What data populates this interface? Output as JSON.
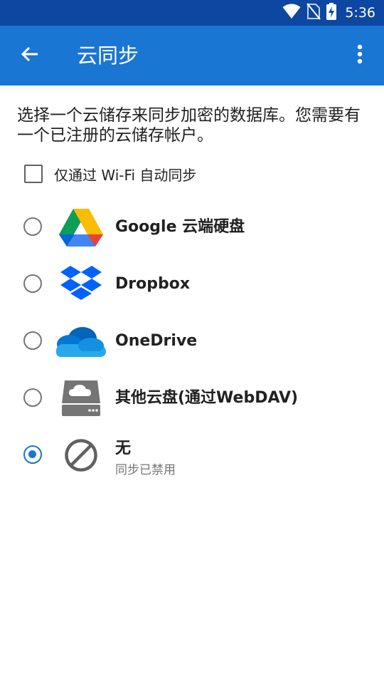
{
  "status_bar": {
    "time": "5:36",
    "icons": [
      "wifi-icon",
      "no-sim-icon",
      "battery-charging-icon"
    ]
  },
  "app_bar": {
    "title": "云同步",
    "back_icon": "arrow-back-icon",
    "overflow_icon": "more-vert-icon"
  },
  "description": "选择一个云储存来同步加密的数据库。您需要有一个已注册的云储存帐户。",
  "wifi_only": {
    "label": "仅通过 Wi-Fi 自动同步",
    "checked": false
  },
  "providers": [
    {
      "label": "Google 云端硬盘",
      "icon": "google-drive-icon",
      "selected": false
    },
    {
      "label": "Dropbox",
      "icon": "dropbox-icon",
      "selected": false
    },
    {
      "label": "OneDrive",
      "icon": "onedrive-icon",
      "selected": false
    },
    {
      "label": "其他云盘(通过WebDAV)",
      "icon": "webdav-drive-icon",
      "selected": false
    },
    {
      "label": "无",
      "sublabel": "同步已禁用",
      "icon": "disabled-icon",
      "selected": true
    }
  ],
  "colors": {
    "status_bar": "#0d47a1",
    "app_bar": "#1976d2",
    "accent": "#1976d2"
  }
}
